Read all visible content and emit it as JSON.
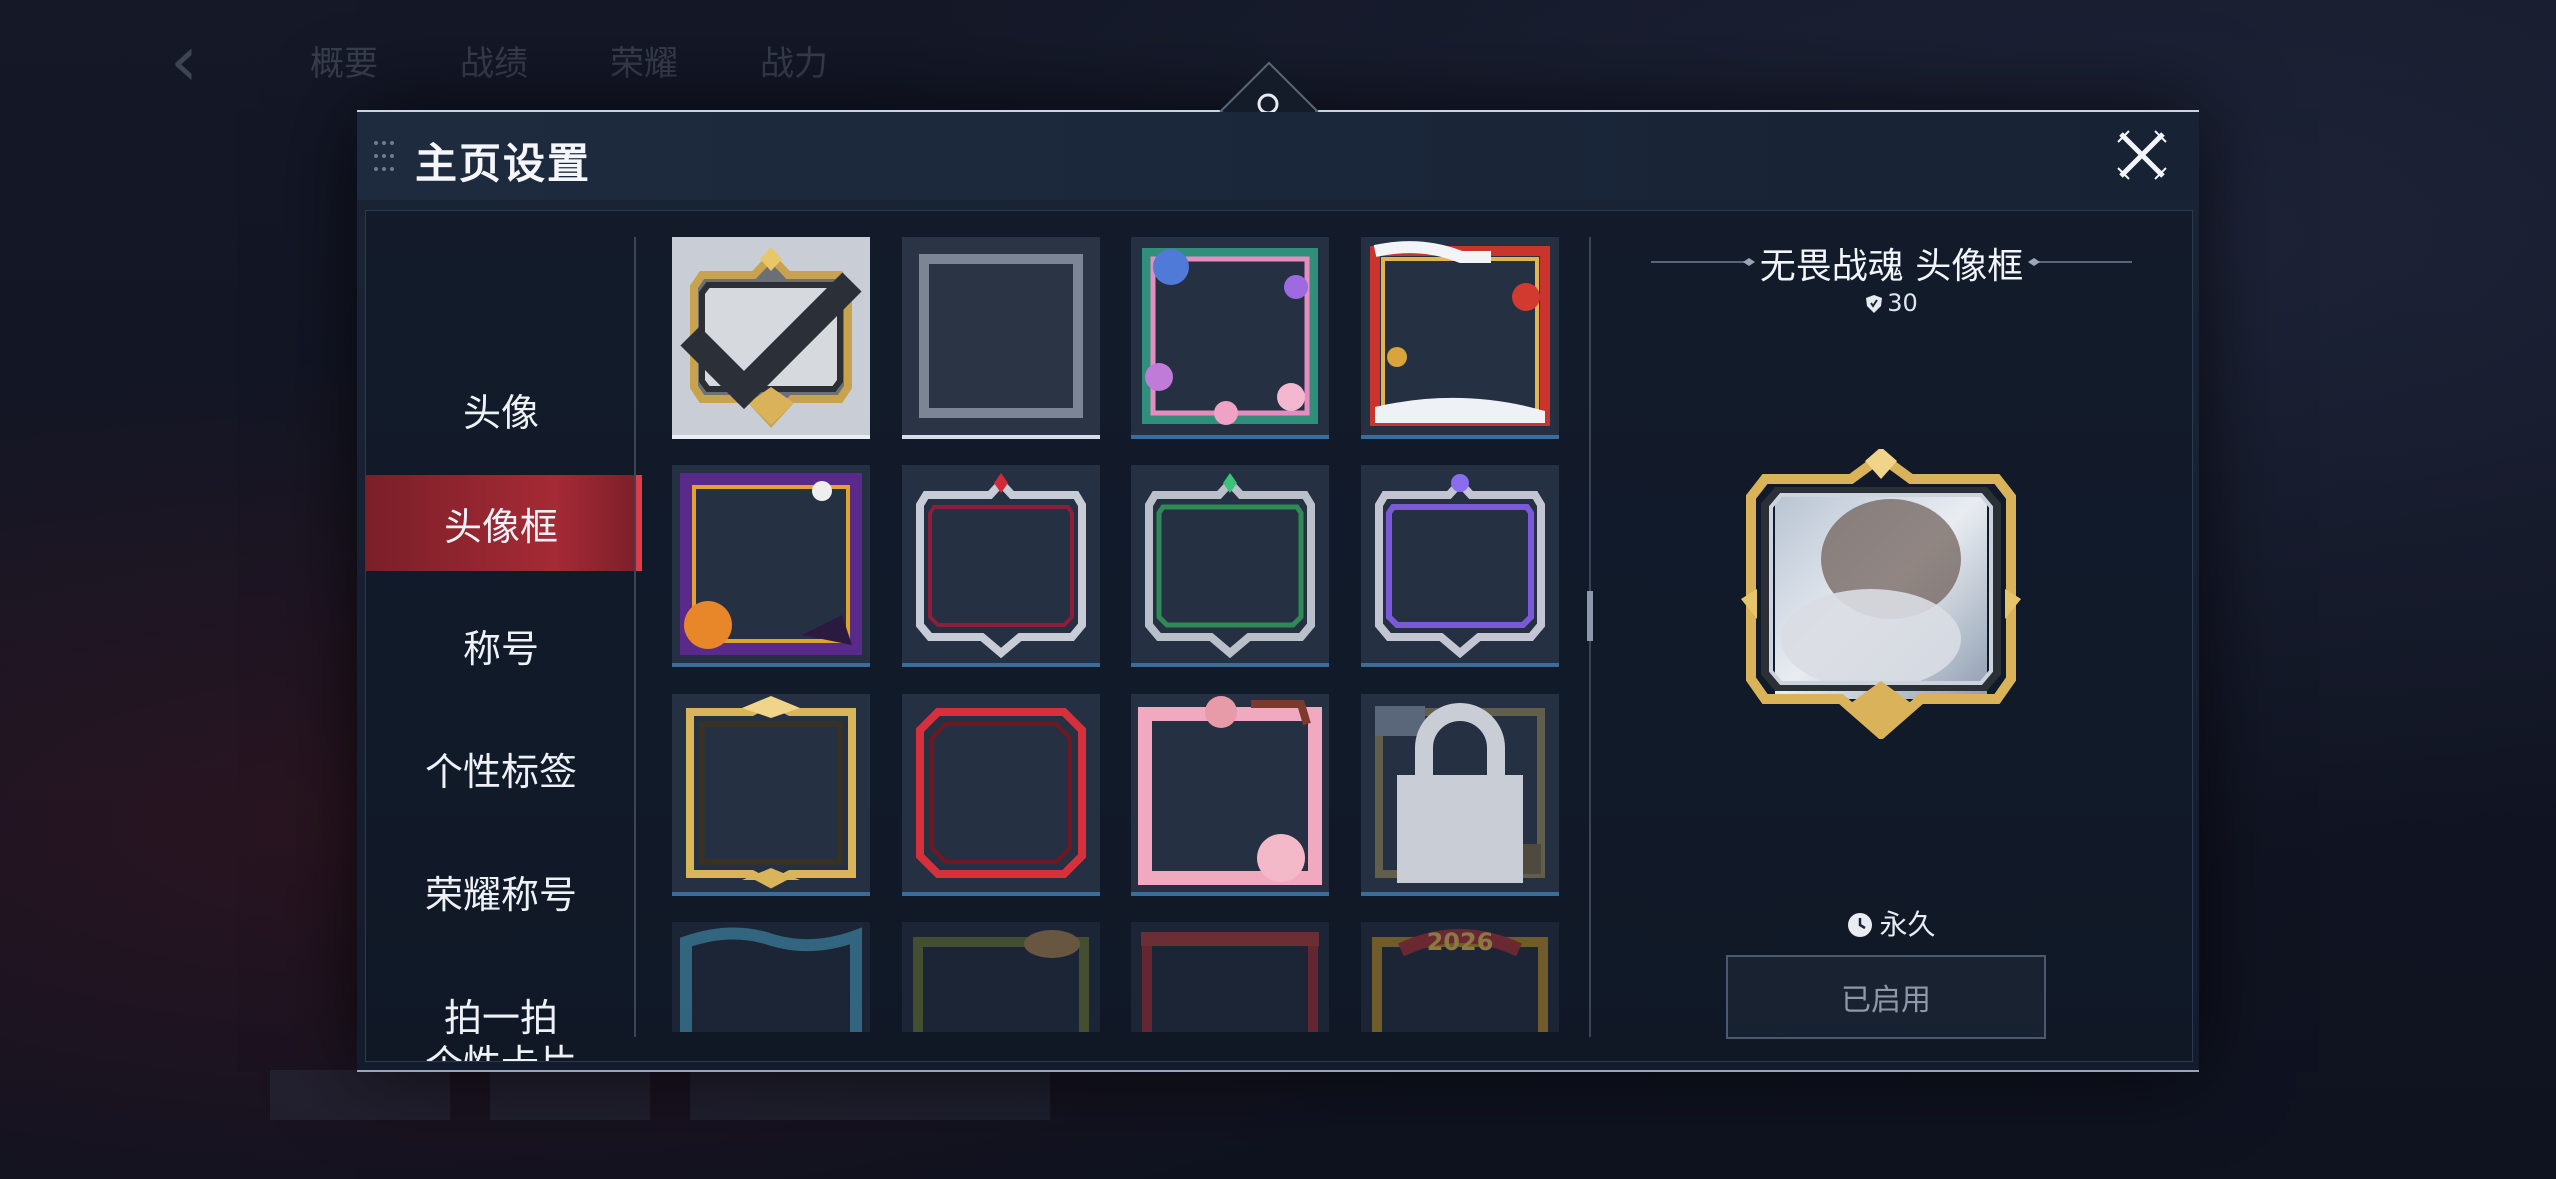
{
  "background": {
    "tabs": [
      "概要",
      "战绩",
      "荣耀",
      "战力"
    ]
  },
  "dialog": {
    "title": "主页设置"
  },
  "sidebar": {
    "items": [
      {
        "label": "头像",
        "active": false
      },
      {
        "label": "头像框",
        "active": true
      },
      {
        "label": "称号",
        "active": false
      },
      {
        "label": "个性标签",
        "active": false
      },
      {
        "label": "荣耀称号",
        "active": false
      },
      {
        "label": "拍一拍",
        "active": false
      },
      {
        "label": "个性卡片",
        "active": false
      }
    ]
  },
  "grid": {
    "frames": [
      {
        "icon": "gold-diamond-frame-icon",
        "selected": true
      },
      {
        "icon": "empty-frame-icon",
        "empty": true
      },
      {
        "icon": "butterfly-flower-frame-icon"
      },
      {
        "icon": "lantern-festival-frame-icon"
      },
      {
        "icon": "halloween-pumpkin-frame-icon"
      },
      {
        "icon": "red-gem-silver-frame-icon"
      },
      {
        "icon": "green-gem-frame-icon"
      },
      {
        "icon": "purple-gem-frame-icon"
      },
      {
        "icon": "gold-wing-frame-icon"
      },
      {
        "icon": "red-simple-frame-icon"
      },
      {
        "icon": "pink-rose-frame-icon"
      },
      {
        "icon": "book-scroll-frame-icon",
        "locked": true
      },
      {
        "icon": "blue-wave-frame-icon"
      },
      {
        "icon": "leaf-hat-frame-icon"
      },
      {
        "icon": "red-gate-frame-icon"
      },
      {
        "icon": "year-2026-frame-icon",
        "text": "2026"
      }
    ]
  },
  "detail": {
    "name": "无畏战魂 头像框",
    "level": "30",
    "duration": "永久",
    "status_label": "已启用"
  },
  "colors": {
    "accent_red": "#a52a35",
    "frame_gold": "#d9b25a",
    "frame_silver": "#cdd3dc"
  }
}
